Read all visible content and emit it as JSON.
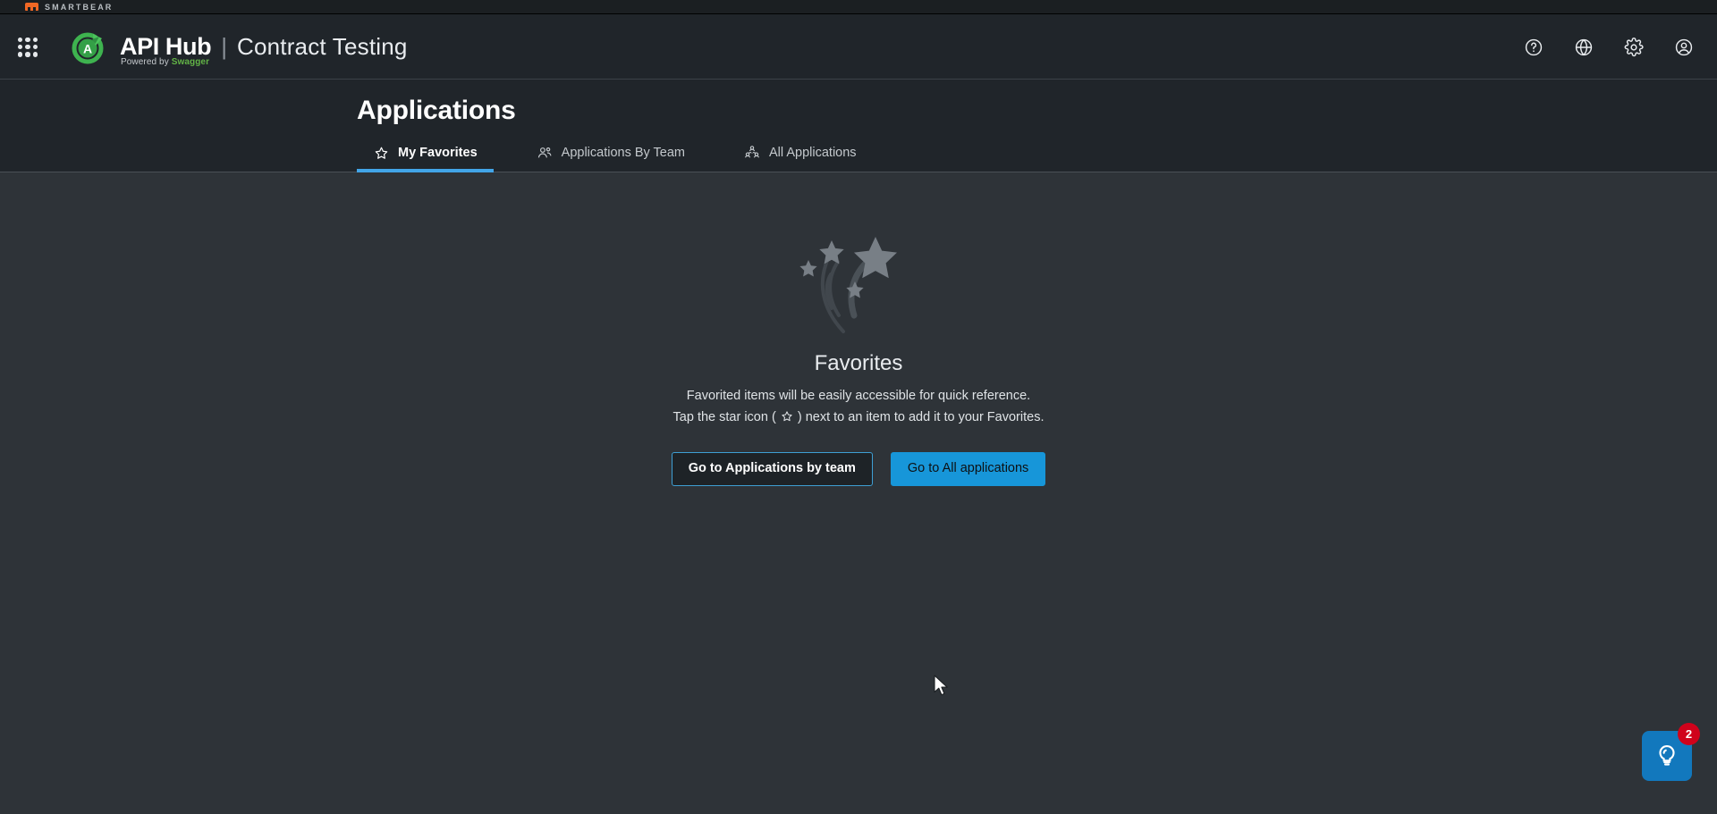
{
  "vendor_strip": {
    "brand": "SMARTBEAR",
    "logo_icon": "smartbear-logo-icon"
  },
  "topbar": {
    "apps_grid_icon": "apps-grid-icon",
    "logo_icon": "api-hub-circle-logo-icon",
    "product_primary": "API Hub",
    "separator": "|",
    "product_secondary": "Contract Testing",
    "powered_prefix": "Powered by",
    "powered_brand": "Swagger",
    "actions": [
      {
        "name": "help-icon",
        "label": "Help"
      },
      {
        "name": "globe-icon",
        "label": "Language"
      },
      {
        "name": "gear-icon",
        "label": "Settings"
      },
      {
        "name": "user-account-icon",
        "label": "Account"
      }
    ]
  },
  "page": {
    "title": "Applications"
  },
  "tabs": [
    {
      "label": "My Favorites",
      "icon": "star-outline-icon",
      "active": true
    },
    {
      "label": "Applications By Team",
      "icon": "team-people-icon",
      "active": false
    },
    {
      "label": "All Applications",
      "icon": "org-hierarchy-icon",
      "active": false
    }
  ],
  "empty_state": {
    "illustration_icon": "shooting-stars-illustration-icon",
    "title": "Favorites",
    "line1": "Favorited items will be easily accessible for quick reference.",
    "line2_before": "Tap the star icon ( ",
    "line2_star_icon": "star-outline-icon",
    "line2_after": " ) next to an item to add it to your Favorites.",
    "buttons": {
      "secondary": "Go to Applications by team",
      "primary": "Go to All applications"
    }
  },
  "help_widget": {
    "icon": "lightbulb-icon",
    "badge_count": "2"
  },
  "colors": {
    "topbar_bg": "#20252a",
    "content_bg": "#2e3338",
    "strip_bg": "#1b1f22",
    "accent_blue": "#42a5e8",
    "primary_button": "#1796d9",
    "badge_red": "#d0021b",
    "swagger_green": "#62b346",
    "smartbear_orange": "#f06724"
  }
}
